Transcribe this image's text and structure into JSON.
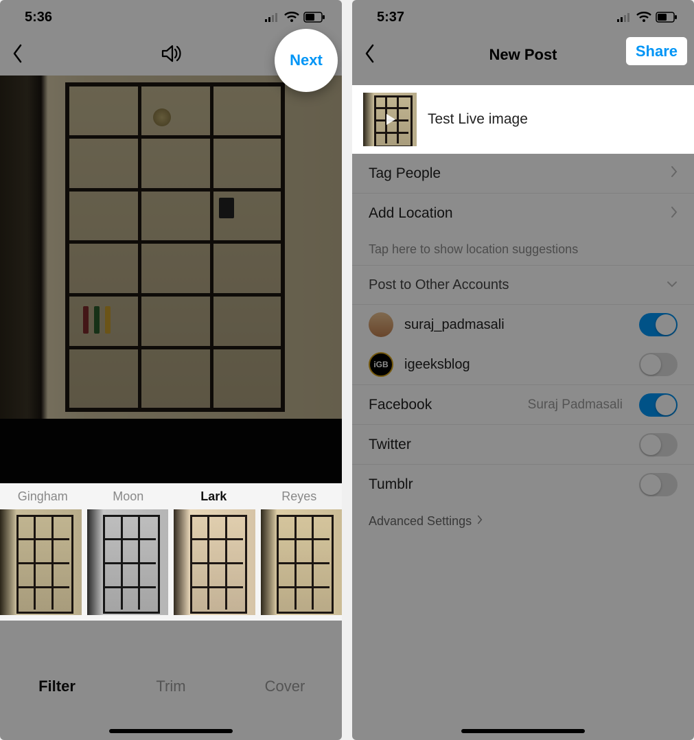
{
  "left": {
    "status_time": "5:36",
    "next_label": "Next",
    "filters": [
      "Gingham",
      "Moon",
      "Lark",
      "Reyes"
    ],
    "selected_filter": "Lark",
    "tabs": [
      "Filter",
      "Trim",
      "Cover"
    ],
    "selected_tab": "Filter"
  },
  "right": {
    "status_time": "5:37",
    "nav_title": "New Post",
    "share_label": "Share",
    "caption": "Test Live image",
    "tag_people": "Tag People",
    "add_location": "Add Location",
    "location_hint": "Tap here to show location suggestions",
    "post_other": "Post to Other Accounts",
    "accounts": [
      {
        "name": "suraj_padmasali",
        "on": true
      },
      {
        "name": "igeeksblog",
        "on": false
      }
    ],
    "shares": [
      {
        "name": "Facebook",
        "sub": "Suraj Padmasali",
        "on": true
      },
      {
        "name": "Twitter",
        "sub": "",
        "on": false
      },
      {
        "name": "Tumblr",
        "sub": "",
        "on": false
      }
    ],
    "advanced": "Advanced Settings"
  }
}
